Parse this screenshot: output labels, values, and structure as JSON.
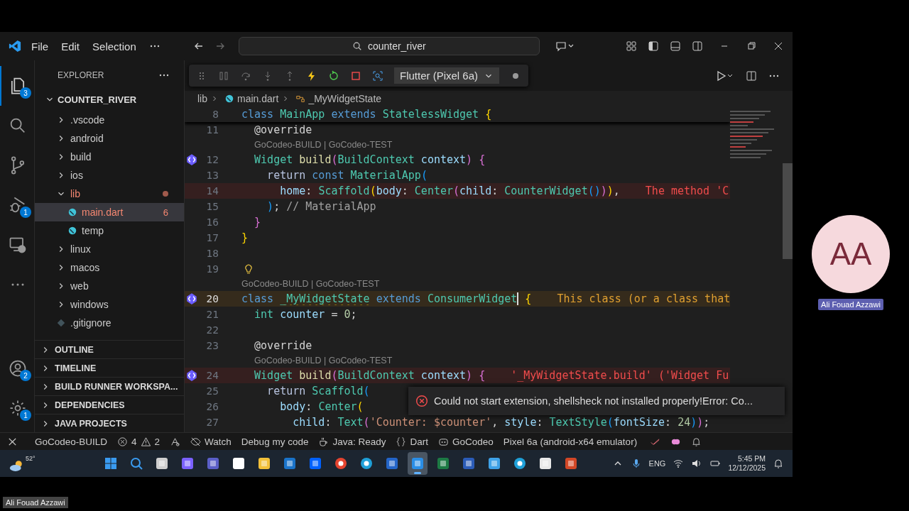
{
  "titlebar": {
    "menus": [
      "File",
      "Edit",
      "Selection"
    ],
    "search": "counter_river"
  },
  "activity_bar": {
    "top": [
      {
        "kind": "files",
        "badge": "3",
        "selected": true
      },
      {
        "kind": "search",
        "selected": false
      },
      {
        "kind": "source-control",
        "selected": false
      },
      {
        "kind": "debug",
        "badge": "1",
        "selected": false
      },
      {
        "kind": "remote",
        "selected": false
      },
      {
        "kind": "more",
        "selected": false
      }
    ],
    "bottom": [
      {
        "kind": "account",
        "badge": "2"
      },
      {
        "kind": "settings",
        "badge": "1"
      }
    ]
  },
  "explorer": {
    "title": "EXPLORER",
    "root": {
      "label": "COUNTER_RIVER",
      "expanded": true,
      "children": [
        {
          "label": ".vscode",
          "kind": "folder",
          "expanded": false,
          "selected": false,
          "error": false
        },
        {
          "label": "android",
          "kind": "folder",
          "expanded": false,
          "selected": false,
          "error": false
        },
        {
          "label": "build",
          "kind": "folder",
          "expanded": false,
          "selected": false,
          "error": false
        },
        {
          "label": "ios",
          "kind": "folder",
          "expanded": false,
          "selected": false,
          "error": false
        },
        {
          "label": "lib",
          "kind": "folder",
          "expanded": true,
          "selected": false,
          "error": true,
          "children": [
            {
              "label": "main.dart",
              "kind": "dart",
              "selected": true,
              "error": true,
              "badge": "6"
            },
            {
              "label": "temp",
              "kind": "dart",
              "selected": false,
              "error": false
            }
          ]
        },
        {
          "label": "linux",
          "kind": "folder",
          "expanded": false,
          "selected": false,
          "error": false
        },
        {
          "label": "macos",
          "kind": "folder",
          "expanded": false,
          "selected": false,
          "error": false
        },
        {
          "label": "web",
          "kind": "folder",
          "expanded": false,
          "selected": false,
          "error": false
        },
        {
          "label": "windows",
          "kind": "folder",
          "expanded": false,
          "selected": false,
          "error": false
        },
        {
          "label": ".gitignore",
          "kind": "git",
          "selected": false,
          "error": false
        }
      ]
    },
    "sections": [
      {
        "label": "OUTLINE",
        "expanded": false
      },
      {
        "label": "TIMELINE",
        "expanded": false
      },
      {
        "label": "BUILD RUNNER WORKSPA...",
        "expanded": false
      },
      {
        "label": "DEPENDENCIES",
        "expanded": false
      },
      {
        "label": "JAVA PROJECTS",
        "expanded": false
      }
    ]
  },
  "debug_toolbar": {
    "target": "Flutter (Pixel 6a)"
  },
  "breadcrumbs": [
    "lib",
    "main.dart",
    "_MyWidgetState"
  ],
  "editor": {
    "lines": [
      {
        "number": "8",
        "sticky": true,
        "tokens": [
          {
            "text": "class",
            "kind": "k"
          },
          {
            "text": " MainApp",
            "kind": "t"
          },
          {
            "text": " extends",
            "kind": "k"
          },
          {
            "text": " StatelessWidget",
            "kind": "t"
          },
          {
            "text": " {",
            "kind": "b1"
          }
        ]
      },
      {
        "number": "11",
        "tokens": [
          {
            "text": "  @override",
            "kind": "p"
          }
        ]
      },
      {
        "number": "12",
        "marker": true,
        "lens": "GoCodeo-BUILD | GoCodeo-TEST",
        "tokens": [
          {
            "text": "  Widget",
            "kind": "t"
          },
          {
            "text": " build",
            "kind": "f"
          },
          {
            "text": "(",
            "kind": "b2"
          },
          {
            "text": "BuildContext",
            "kind": "t"
          },
          {
            "text": " context",
            "kind": "v"
          },
          {
            "text": ")",
            "kind": "b2"
          },
          {
            "text": " {",
            "kind": "b2"
          }
        ]
      },
      {
        "number": "13",
        "tokens": [
          {
            "text": "    return",
            "kind": "c"
          },
          {
            "text": " const",
            "kind": "k"
          },
          {
            "text": " MaterialApp",
            "kind": "t"
          },
          {
            "text": "(",
            "kind": "b3"
          }
        ]
      },
      {
        "number": "14",
        "diagnostic": {
          "kind": "error",
          "message": "The method 'C"
        },
        "tokens": [
          {
            "text": "      home",
            "kind": "v"
          },
          {
            "text": ": ",
            "kind": "p"
          },
          {
            "text": "Scaffold",
            "kind": "t"
          },
          {
            "text": "(",
            "kind": "b1"
          },
          {
            "text": "body",
            "kind": "v"
          },
          {
            "text": ": ",
            "kind": "p"
          },
          {
            "text": "Center",
            "kind": "t"
          },
          {
            "text": "(",
            "kind": "b2"
          },
          {
            "text": "child",
            "kind": "v"
          },
          {
            "text": ": ",
            "kind": "p"
          },
          {
            "text": "CounterWidget",
            "kind": "t",
            "squiggle": true
          },
          {
            "text": "()",
            "kind": "b3",
            "squiggle": true
          },
          {
            "text": ")",
            "kind": "b2"
          },
          {
            "text": ")",
            "kind": "b1"
          },
          {
            "text": ",",
            "kind": "p"
          }
        ]
      },
      {
        "number": "15",
        "tokens": [
          {
            "text": "    )",
            "kind": "b3"
          },
          {
            "text": "; ",
            "kind": "p"
          },
          {
            "text": "// MaterialApp",
            "kind": "m"
          }
        ]
      },
      {
        "number": "16",
        "tokens": [
          {
            "text": "  }",
            "kind": "b2"
          }
        ]
      },
      {
        "number": "17",
        "tokens": [
          {
            "text": "}",
            "kind": "b1"
          }
        ]
      },
      {
        "number": "18"
      },
      {
        "number": "19",
        "lightbulb": true
      },
      {
        "number": "20",
        "marker": true,
        "lens": "GoCodeo-BUILD | GoCodeo-TEST",
        "diagnostic": {
          "kind": "warning",
          "message": "This class (or a class that"
        },
        "tokens": [
          {
            "text": "class ",
            "kind": "k"
          },
          {
            "text": "_MyWidgetState",
            "kind": "t",
            "squiggle": true
          },
          {
            "text": " extends",
            "kind": "k"
          },
          {
            "text": " ConsumerWidget",
            "kind": "t"
          },
          {
            "kind": "cursor"
          },
          {
            "text": " {",
            "kind": "b1"
          }
        ]
      },
      {
        "number": "21",
        "tokens": [
          {
            "text": "  int",
            "kind": "t"
          },
          {
            "text": " counter",
            "kind": "v"
          },
          {
            "text": " = ",
            "kind": "p"
          },
          {
            "text": "0",
            "kind": "n"
          },
          {
            "text": ";",
            "kind": "p"
          }
        ]
      },
      {
        "number": "22"
      },
      {
        "number": "23",
        "tokens": [
          {
            "text": "  @override",
            "kind": "p"
          }
        ]
      },
      {
        "number": "24",
        "marker": true,
        "lens": "GoCodeo-BUILD | GoCodeo-TEST",
        "diagnostic": {
          "kind": "error",
          "message": "'_MyWidgetState.build' ('Widget Fu"
        },
        "tokens": [
          {
            "text": "  Widget ",
            "kind": "t"
          },
          {
            "text": "build",
            "kind": "f",
            "squiggle": true
          },
          {
            "text": "(",
            "kind": "b2"
          },
          {
            "text": "BuildContext",
            "kind": "t"
          },
          {
            "text": " context",
            "kind": "v"
          },
          {
            "text": ")",
            "kind": "b2"
          },
          {
            "text": " {",
            "kind": "b2"
          }
        ]
      },
      {
        "number": "25",
        "tokens": [
          {
            "text": "    return",
            "kind": "c"
          },
          {
            "text": " Scaffold",
            "kind": "t"
          },
          {
            "text": "(",
            "kind": "b3"
          }
        ]
      },
      {
        "number": "26",
        "tokens": [
          {
            "text": "      body",
            "kind": "v"
          },
          {
            "text": ": ",
            "kind": "p"
          },
          {
            "text": "Center",
            "kind": "t"
          },
          {
            "text": "(",
            "kind": "b1"
          }
        ]
      },
      {
        "number": "27",
        "tokens": [
          {
            "text": "        child",
            "kind": "v"
          },
          {
            "text": ": ",
            "kind": "p"
          },
          {
            "text": "Text",
            "kind": "t"
          },
          {
            "text": "(",
            "kind": "b2"
          },
          {
            "text": "'Counter: $counter'",
            "kind": "s"
          },
          {
            "text": ", ",
            "kind": "p"
          },
          {
            "text": "style",
            "kind": "v"
          },
          {
            "text": ": ",
            "kind": "p"
          },
          {
            "text": "TextStyle",
            "kind": "t"
          },
          {
            "text": "(",
            "kind": "b3"
          },
          {
            "text": "fontSize",
            "kind": "v"
          },
          {
            "text": ": ",
            "kind": "p"
          },
          {
            "text": "24",
            "kind": "n"
          },
          {
            "text": ")",
            "kind": "b3"
          },
          {
            "text": ")",
            "kind": "b2"
          },
          {
            "text": ";",
            "kind": "p"
          }
        ]
      }
    ]
  },
  "notification": {
    "kind": "error",
    "message": "Could not start extension, shellsheck not installed properly!Error: Co..."
  },
  "status_bar": {
    "items": [
      {
        "kind": "remote"
      },
      {
        "kind": "text",
        "label": "GoCodeo-BUILD"
      },
      {
        "kind": "problems",
        "errors": "4",
        "warnings": "2"
      },
      {
        "kind": "broadcast"
      },
      {
        "kind": "watch",
        "label": "Watch"
      },
      {
        "kind": "text",
        "label": "Debug my code"
      },
      {
        "kind": "java",
        "label": "Java: Ready"
      },
      {
        "kind": "braces",
        "label": "Dart"
      },
      {
        "kind": "robot",
        "label": "GoCodeo"
      },
      {
        "kind": "text",
        "label": "Pixel 6a (android-x64 emulator)"
      },
      {
        "kind": "check"
      },
      {
        "kind": "brain"
      },
      {
        "kind": "bell"
      }
    ]
  },
  "taskbar": {
    "weather": "52°",
    "apps": [
      {
        "kind": "windows",
        "selected": false
      },
      {
        "kind": "search",
        "selected": false
      },
      {
        "kind": "taskview",
        "selected": false
      },
      {
        "kind": "copilot",
        "selected": false
      },
      {
        "kind": "teams",
        "selected": false
      },
      {
        "kind": "amazon",
        "selected": false
      },
      {
        "kind": "folder",
        "selected": false
      },
      {
        "kind": "outlook",
        "selected": false
      },
      {
        "kind": "dropbox",
        "selected": false
      },
      {
        "kind": "chrome",
        "selected": false
      },
      {
        "kind": "edge",
        "selected": false
      },
      {
        "kind": "lens",
        "selected": false
      },
      {
        "kind": "vscode",
        "selected": true
      },
      {
        "kind": "excel",
        "selected": false
      },
      {
        "kind": "word",
        "selected": false
      },
      {
        "kind": "notepad",
        "selected": false
      },
      {
        "kind": "edge",
        "selected": false
      },
      {
        "kind": "doc",
        "selected": false
      },
      {
        "kind": "powerpoint",
        "selected": false
      }
    ],
    "language": "ENG",
    "time": "5:45 PM",
    "date": "12/12/2025"
  },
  "meeting": {
    "avatar_initials": "AA",
    "participant_name": "Ali Fouad Azzawi",
    "presenter_name": "Ali Fouad Azzawi"
  }
}
